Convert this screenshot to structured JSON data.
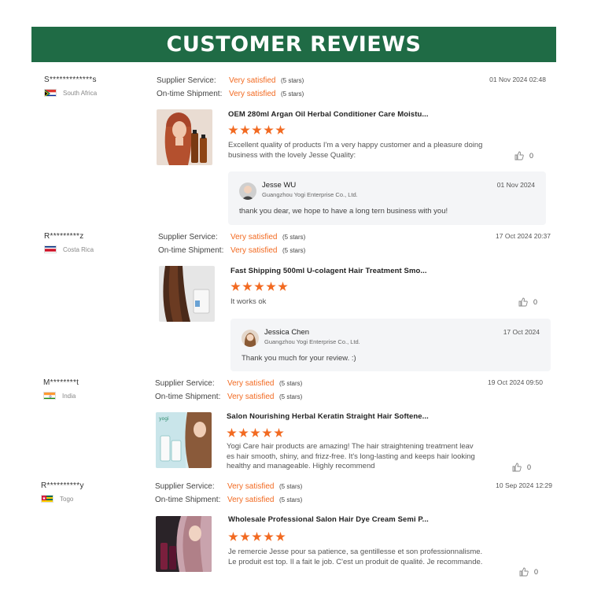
{
  "banner": {
    "title": "CUSTOMER REVIEWS"
  },
  "labels": {
    "supplier_service": "Supplier Service:",
    "on_time_shipment": "On-time Shipment:"
  },
  "colors": {
    "brand": "#1f6b45",
    "accent": "#f26a21",
    "reply_bg": "#f4f5f7"
  },
  "reviews": [
    {
      "name": "S*************s",
      "country": "South Africa",
      "flag_icon": "south-africa-flag-icon",
      "supplier_service": "Very satisfied",
      "supplier_stars": "(5 stars)",
      "shipment": "Very satisfied",
      "shipment_stars": "(5 stars)",
      "timestamp": "01 Nov 2024 02:48",
      "product_title": "OEM 280ml Argan Oil Herbal Conditioner Care Moistu...",
      "rating": 5,
      "text": "Excellent quality of products I'm a very happy customer and a pleasure doing business with the lovely Jesse  Quality:",
      "likes": "0",
      "reply": {
        "name": "Jesse WU",
        "company": "Guangzhou Yogi Enterprise Co., Ltd.",
        "date": "01 Nov 2024",
        "text": "thank you dear, we hope to have a long tern business with you!"
      }
    },
    {
      "name": "R*********z",
      "country": "Costa Rica",
      "flag_icon": "costa-rica-flag-icon",
      "supplier_service": "Very satisfied",
      "supplier_stars": "(5 stars)",
      "shipment": "Very satisfied",
      "shipment_stars": "(5 stars)",
      "timestamp": "17 Oct 2024 20:37",
      "product_title": "Fast Shipping 500ml U-colagent Hair Treatment Smo...",
      "rating": 5,
      "text": "It works ok",
      "likes": "0",
      "reply": {
        "name": "Jessica Chen",
        "company": "Guangzhou Yogi Enterprise Co., Ltd.",
        "date": "17 Oct 2024",
        "text": "Thank you much for your review. :)"
      }
    },
    {
      "name": "M********t",
      "country": "India",
      "flag_icon": "india-flag-icon",
      "supplier_service": "Very satisfied",
      "supplier_stars": "(5 stars)",
      "shipment": "Very satisfied",
      "shipment_stars": "(5 stars)",
      "timestamp": "19 Oct 2024 09:50",
      "product_title": "Salon Nourishing Herbal Keratin Straight Hair Softene...",
      "rating": 5,
      "text": "Yogi Care hair products are amazing! The hair straightening treatment leaves hair smooth, shiny, and frizz-free. It's long-lasting and keeps hair looking healthy and manageable. Highly recommend",
      "likes": "0"
    },
    {
      "name": "R**********y",
      "country": "Togo",
      "flag_icon": "togo-flag-icon",
      "supplier_service": "Very satisfied",
      "supplier_stars": "(5 stars)",
      "shipment": "Very satisfied",
      "shipment_stars": "(5 stars)",
      "timestamp": "10 Sep 2024 12:29",
      "product_title": "Wholesale Professional Salon Hair Dye Cream Semi P...",
      "rating": 5,
      "text": "Je remercie Jesse pour sa patience, sa gentillesse et son professionnalisme. Le produit est top. Il a fait le job. C'est un produit de qualité. Je recommande.",
      "likes": "0"
    }
  ]
}
